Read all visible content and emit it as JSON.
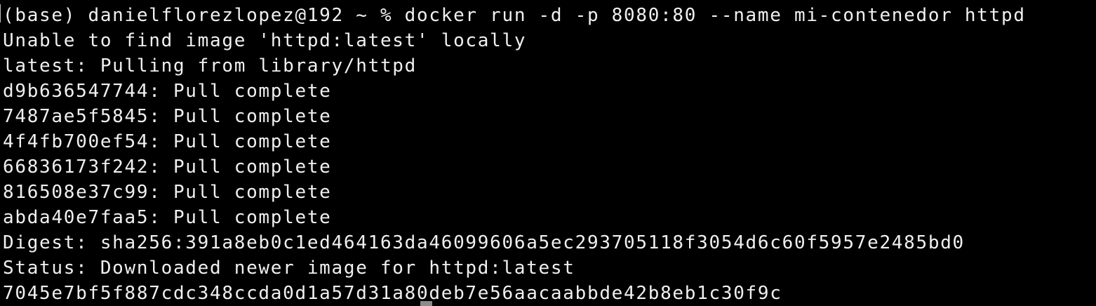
{
  "terminal": {
    "lines": [
      "(base) danielflorezlopez@192 ~ % docker run -d -p 8080:80 --name mi-contenedor httpd",
      "Unable to find image 'httpd:latest' locally",
      "latest: Pulling from library/httpd",
      "d9b636547744: Pull complete",
      "7487ae5f5845: Pull complete",
      "4f4fb700ef54: Pull complete",
      "66836173f242: Pull complete",
      "816508e37c99: Pull complete",
      "abda40e7faa5: Pull complete",
      "Digest: sha256:391a8eb0c1ed464163da46099606a5ec293705118f3054d6c60f5957e2485bd0",
      "Status: Downloaded newer image for httpd:latest",
      "7045e7bf5f887cdc348ccda0d1a57d31a80deb7e56aacaabbde42b8eb1c30f9c"
    ],
    "colors": {
      "background": "#000000",
      "text": "#f0f0f0",
      "cursor": "#8a8a8a"
    }
  }
}
